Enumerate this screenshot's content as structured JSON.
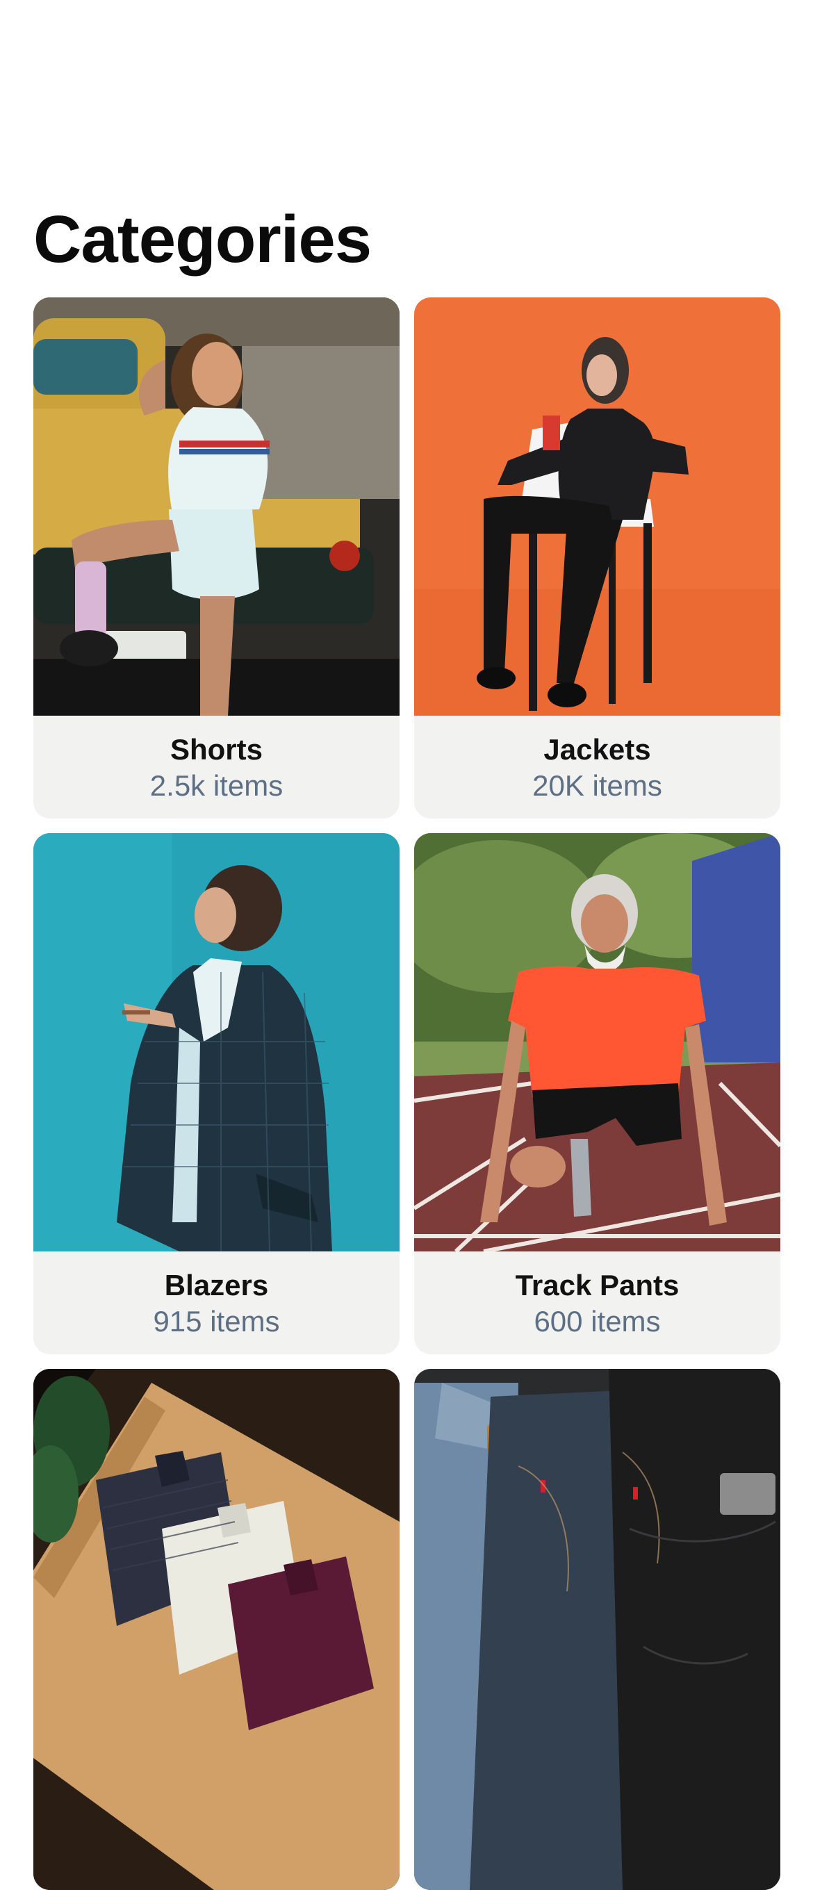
{
  "page": {
    "title": "Categories"
  },
  "categories": [
    {
      "name": "Shorts",
      "count": "2.5k items",
      "image": "woman-in-white-shorts-photo"
    },
    {
      "name": "Jackets",
      "count": "20K items",
      "image": "woman-in-black-leather-jacket-photo"
    },
    {
      "name": "Blazers",
      "count": "915 items",
      "image": "woman-in-plaid-blazer-photo"
    },
    {
      "name": "Track Pants",
      "count": "600 items",
      "image": "man-on-running-track-photo"
    },
    {
      "name": "",
      "count": "",
      "image": "folded-dress-shirts-photo"
    },
    {
      "name": "",
      "count": "",
      "image": "stacked-jeans-photo"
    }
  ],
  "colors": {
    "background": "#ffffff",
    "card_background": "#f2f2f1",
    "title_text": "#0b0b0b",
    "name_text": "#121212",
    "count_text": "#5d6f84"
  }
}
